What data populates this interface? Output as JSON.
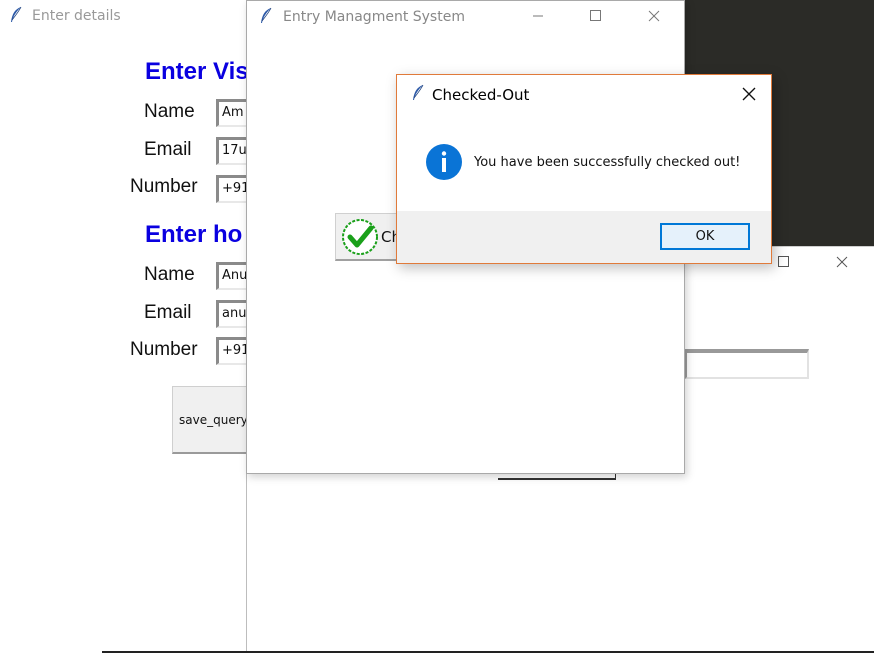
{
  "details_window": {
    "title": "Enter details",
    "visitor_heading": "Enter Vis",
    "host_heading": "Enter ho",
    "visitor": {
      "name_label": "Name",
      "name_value": "Am",
      "email_label": "Email",
      "email_value": "17u",
      "number_label": "Number",
      "number_value": "+91"
    },
    "host": {
      "name_label": "Name",
      "name_value": "Anu",
      "email_label": "Email",
      "email_value": "anu",
      "number_label": "Number",
      "number_value": "+91"
    },
    "save_button_label": "save_query"
  },
  "ems_window": {
    "title": "Entry Managment System",
    "checkout_button_label": "Ch"
  },
  "dialog": {
    "title": "Checked-Out",
    "message": "You have been successfully checked out!",
    "ok_label": "OK",
    "icon": "info-icon"
  },
  "colors": {
    "heading": "#0a00e0",
    "dialog_border": "#e07a3a",
    "ok_border": "#0078d7",
    "info_icon": "#0a74d6",
    "check_icon": "#1aa01a"
  }
}
